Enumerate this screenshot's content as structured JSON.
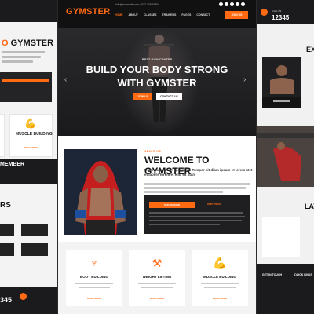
{
  "accent": "#ff6a13",
  "center": {
    "brand": "GYMSTER",
    "topline": "info@example.com   +012 345 6789",
    "nav": [
      "HOME",
      "ABOUT",
      "CLASSES",
      "TRAINERS",
      "PAGES",
      "CONTACT"
    ],
    "join": "JOIN US",
    "hero": {
      "kicker": "BEST GYM CENTER",
      "title_1": "BUILD YOUR BODY STRONG",
      "title_2": "WITH GYMSTER",
      "btn_1": "JOIN US",
      "btn_2": "CONTACT US"
    },
    "about": {
      "kicker": "ABOUT US",
      "title": "WELCOME TO GYMSTER",
      "lead": "Dolor diam lorem ipsum sit. Tempor sit diam ipsum et lorem stet et labore lorem et elitr sit diam",
      "tab_1": "OUR MISSION",
      "tab_2": "OUR VISION"
    },
    "services": [
      {
        "icon": "weightlifter-icon",
        "glyph": "♆",
        "title": "BODY BUILDING",
        "link": "READ MORE"
      },
      {
        "icon": "dumbbell-icon",
        "glyph": "⚒",
        "title": "WEIGHT LIFTING",
        "link": "READ MORE"
      },
      {
        "icon": "muscle-arm-icon",
        "glyph": "💪",
        "title": "MUSCLE BUILDING",
        "link": "READ MORE"
      }
    ]
  },
  "left": {
    "title_1": "O",
    "title_2": "GYMSTER",
    "card_title": "MUSCLE BUILDING",
    "card_link": "READ MORE",
    "member": "MEMBER",
    "rs": "RS",
    "phone": "345"
  },
  "right": {
    "phone_label": "CALL US",
    "phone": "12345",
    "ex": "EX",
    "lat": "LAT",
    "foot_1": "GET IN TOUCH",
    "foot_2": "QUICK LINKS"
  }
}
